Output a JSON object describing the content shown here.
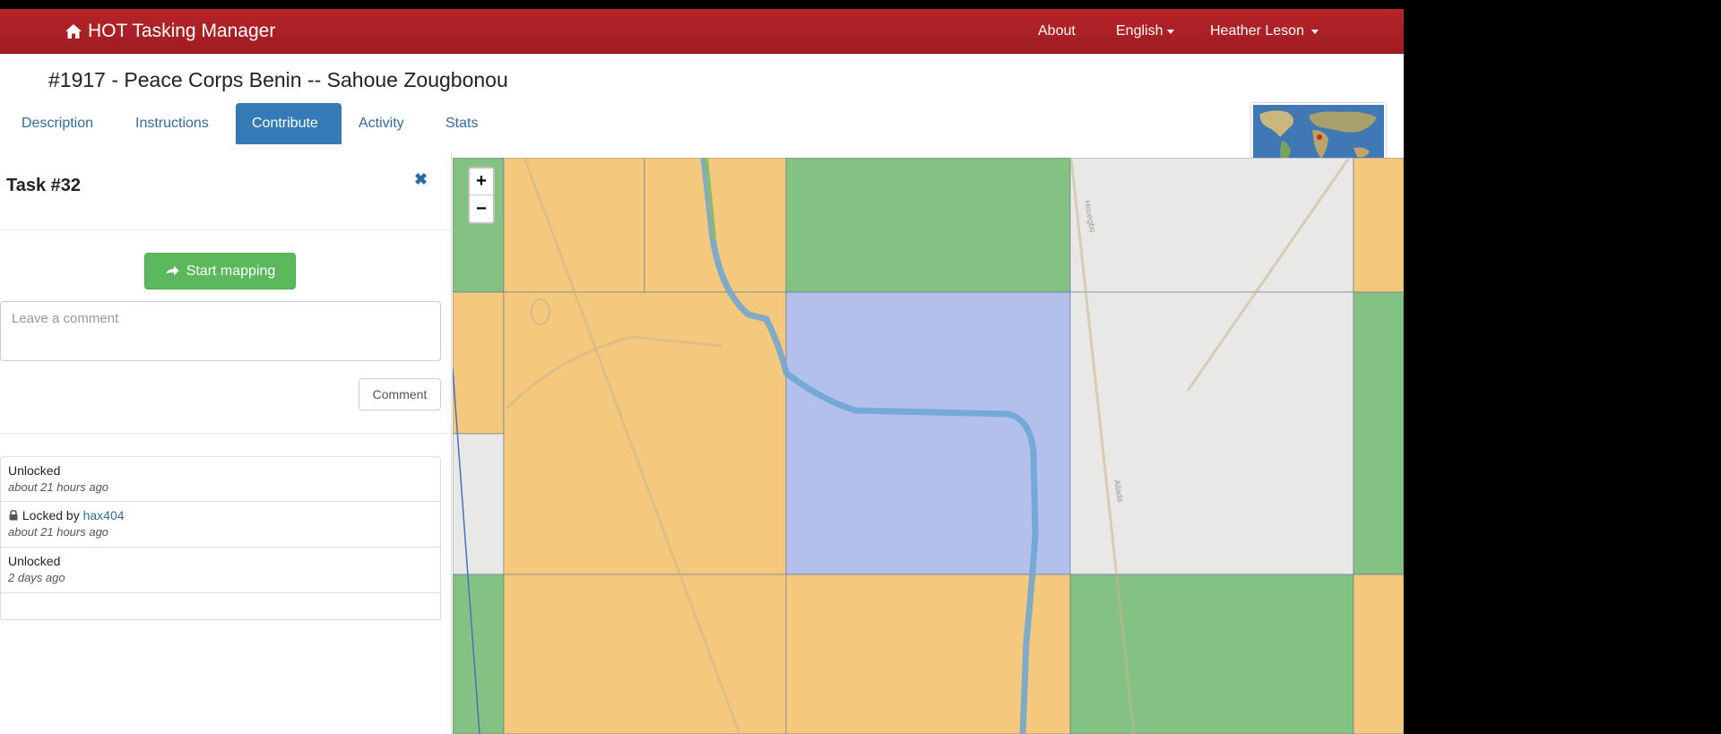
{
  "navbar": {
    "brand": "HOT Tasking Manager",
    "about": "About",
    "language": "English",
    "user": "Heather Leson"
  },
  "project": {
    "title": "#1917 - Peace Corps Benin -- Sahoue Zougbonou"
  },
  "tabs": [
    {
      "label": "Description"
    },
    {
      "label": "Instructions"
    },
    {
      "label": "Contribute"
    },
    {
      "label": "Activity"
    },
    {
      "label": "Stats"
    }
  ],
  "task": {
    "title": "Task #32",
    "start_label": "Start mapping",
    "comment_placeholder": "Leave a comment",
    "comment_button": "Comment"
  },
  "history": [
    {
      "action": "Unlocked",
      "user": "",
      "time": "about 21 hours ago",
      "locked": false
    },
    {
      "action": "Locked by",
      "user": "hax404",
      "time": "about 21 hours ago",
      "locked": true
    },
    {
      "action": "Unlocked",
      "user": "",
      "time": "2 days ago",
      "locked": false
    }
  ],
  "map": {
    "zoom_in": "+",
    "zoom_out": "−",
    "road_labels": [
      "Houegbo",
      "Allada"
    ]
  },
  "colors": {
    "navbar": "#a81f24",
    "active_tab": "#337ab7",
    "start_button": "#5cb85c",
    "tile_ready": "#f5c97d",
    "tile_mapped": "#84c283",
    "tile_validated": "#b4c0ec",
    "tile_empty": "#e8e8e6"
  }
}
